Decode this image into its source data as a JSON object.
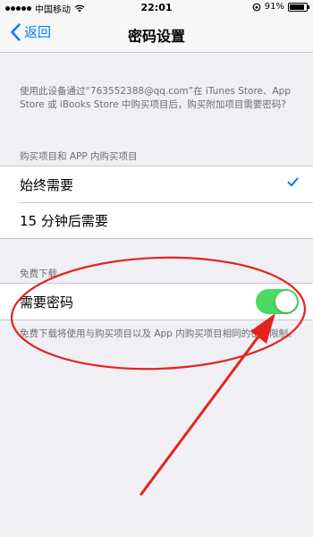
{
  "status_bar": {
    "carrier": "中国移动",
    "time": "22:01",
    "battery_percent": "91%",
    "battery_level": 0.91
  },
  "nav": {
    "back_label": "返回",
    "title": "密码设置"
  },
  "description": "使用此设备通过“763552388@qq.com”在 iTunes Store、App Store 或 iBooks Store 中购买项目后，购买附加项目需要密码?",
  "purchases_section": {
    "header": "购买项目和 APP 内购买项目",
    "options": [
      {
        "label": "始终需要",
        "selected": true
      },
      {
        "label": "15 分钟后需要",
        "selected": false
      }
    ]
  },
  "free_downloads_section": {
    "header": "免费下载",
    "toggle_label": "需要密码",
    "toggle_on": true,
    "footer": "免费下载将使用与购买项目以及 App 内购买项目相同的密码限制。"
  },
  "colors": {
    "accent": "#007aff",
    "toggle_on": "#4cd964",
    "annotation": "#e5231b"
  }
}
